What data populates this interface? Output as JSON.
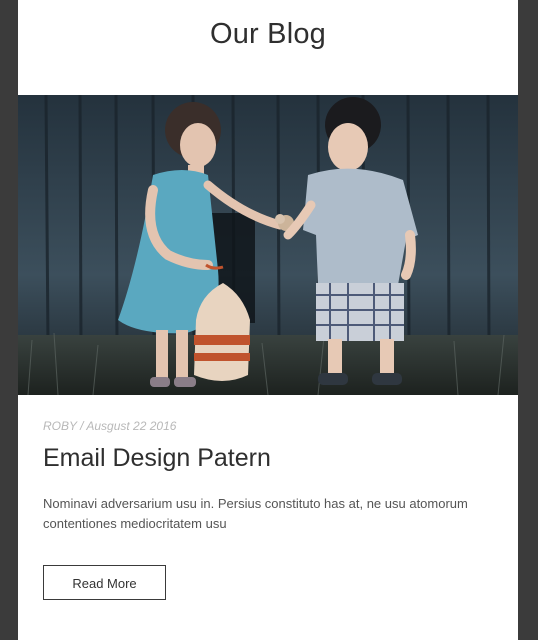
{
  "blog": {
    "heading": "Our Blog"
  },
  "post": {
    "meta": "ROBY / Ausgust 22 2016",
    "title": "Email Design Patern",
    "excerpt": "Nominavi adversarium usu in. Persius constituto has at, ne usu atomorum contentiones mediocritatem usu",
    "button_label": "Read More",
    "image_alt": "Two children sharing a flower in front of a wooden wall"
  },
  "colors": {
    "page_background": "#3b3b3b",
    "card_background": "#ffffff",
    "text_dark": "#2f2f2f",
    "meta_text": "#b8b8b8"
  }
}
